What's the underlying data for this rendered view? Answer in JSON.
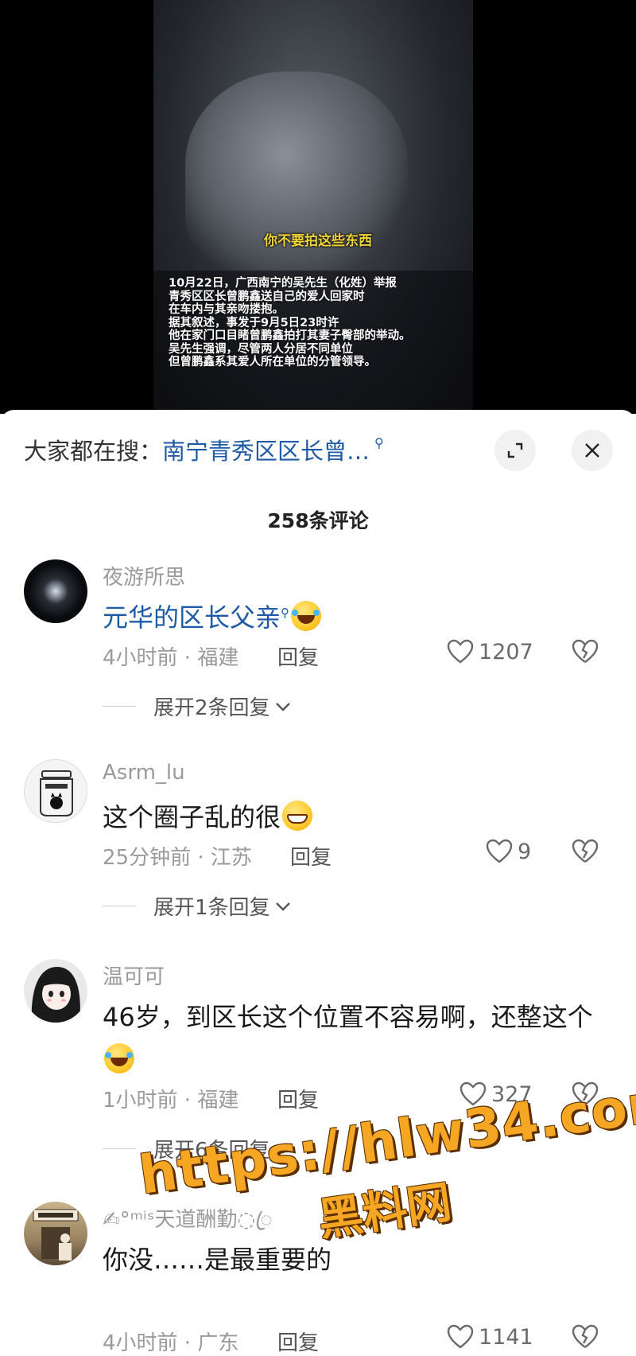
{
  "video": {
    "subtitle": "你不要拍这些东西",
    "caption_lines": [
      "10月22日，广西南宁的吴先生（化姓）举报",
      "青秀区区长曾鹏鑫送自己的爱人回家时",
      "在车内与其亲吻搂抱。",
      "据其叙述，事发于9月5日23时许",
      "他在家门口目睹曾鹏鑫拍打其妻子臀部的举动。",
      "吴先生强调，尽管两人分居不同单位",
      "但曾鹏鑫系其爱人所在单位的分管领导。"
    ]
  },
  "search": {
    "prefix": "大家都在搜：",
    "term": "南宁青秀区区长曾…",
    "icon": "search-icon"
  },
  "header": {
    "expand_icon": "expand-icon",
    "close_icon": "close-icon",
    "comment_count": "258条评论"
  },
  "comments": [
    {
      "username": "夜游所思",
      "text": "元华的区长父亲",
      "emoji": "laughing-tears-emoji",
      "time_location": "4小时前 · 福建",
      "reply_label": "回复",
      "likes": "1207",
      "expand_replies": "展开2条回复"
    },
    {
      "username": "Asrm_lu",
      "text": "这个圈子乱的很",
      "emoji": "grinning-emoji",
      "time_location": "25分钟前 · 江苏",
      "reply_label": "回复",
      "likes": "9",
      "expand_replies": "展开1条回复"
    },
    {
      "username": "温可可",
      "text": "46岁，到区长这个位置不容易啊，还整这个",
      "emoji": "laughing-tears-emoji",
      "time_location": "1小时前 · 福建",
      "reply_label": "回复",
      "likes": "327",
      "expand_replies": "展开6条回复"
    },
    {
      "username": "✍°ᵐⁱˢ天道酬勤◌ꦿ",
      "text": "你没……是最重要的",
      "time_location": "4小时前 · 广东",
      "reply_label": "回复",
      "likes": "1141"
    }
  ],
  "watermark": {
    "url": "https://hlw34.com",
    "site": "黑料网"
  },
  "colors": {
    "link": "#1f5aa6",
    "muted": "#9a9a9a",
    "watermark": "#f5a623",
    "subtitle": "#f2d43b"
  }
}
